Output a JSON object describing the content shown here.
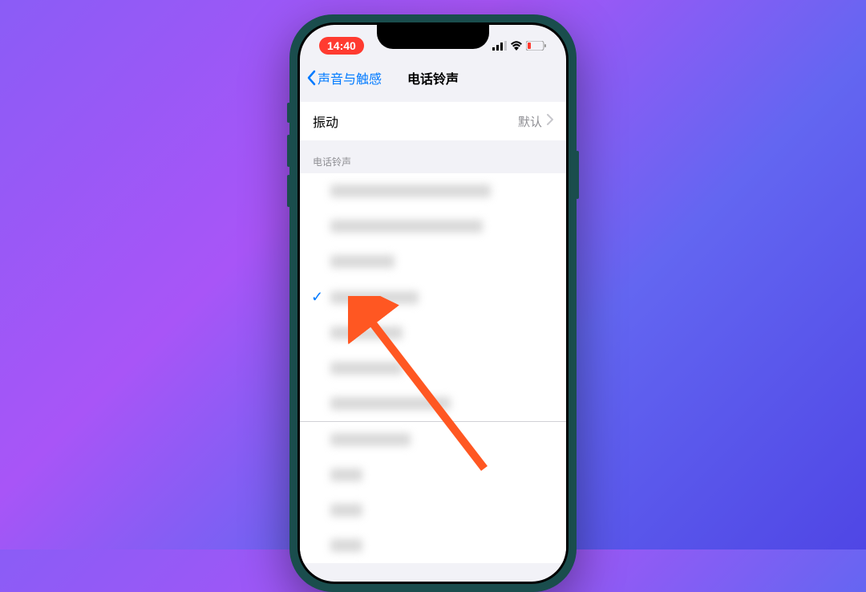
{
  "status": {
    "time": "14:40"
  },
  "nav": {
    "back_label": "声音与触感",
    "title": "电话铃声"
  },
  "vibration": {
    "label": "振动",
    "value": "默认"
  },
  "section_header": "电话铃声",
  "ringtones": [
    {
      "selected": false,
      "width_class": "w1"
    },
    {
      "selected": false,
      "width_class": "w2"
    },
    {
      "selected": false,
      "width_class": "w3"
    },
    {
      "selected": true,
      "width_class": "w4"
    },
    {
      "selected": false,
      "width_class": "w5"
    },
    {
      "selected": false,
      "width_class": "w6"
    },
    {
      "selected": false,
      "width_class": "w7"
    },
    {
      "selected": false,
      "width_class": "w8"
    },
    {
      "selected": false,
      "width_class": "w9"
    },
    {
      "selected": false,
      "width_class": "w10"
    },
    {
      "selected": false,
      "width_class": "w11"
    }
  ]
}
